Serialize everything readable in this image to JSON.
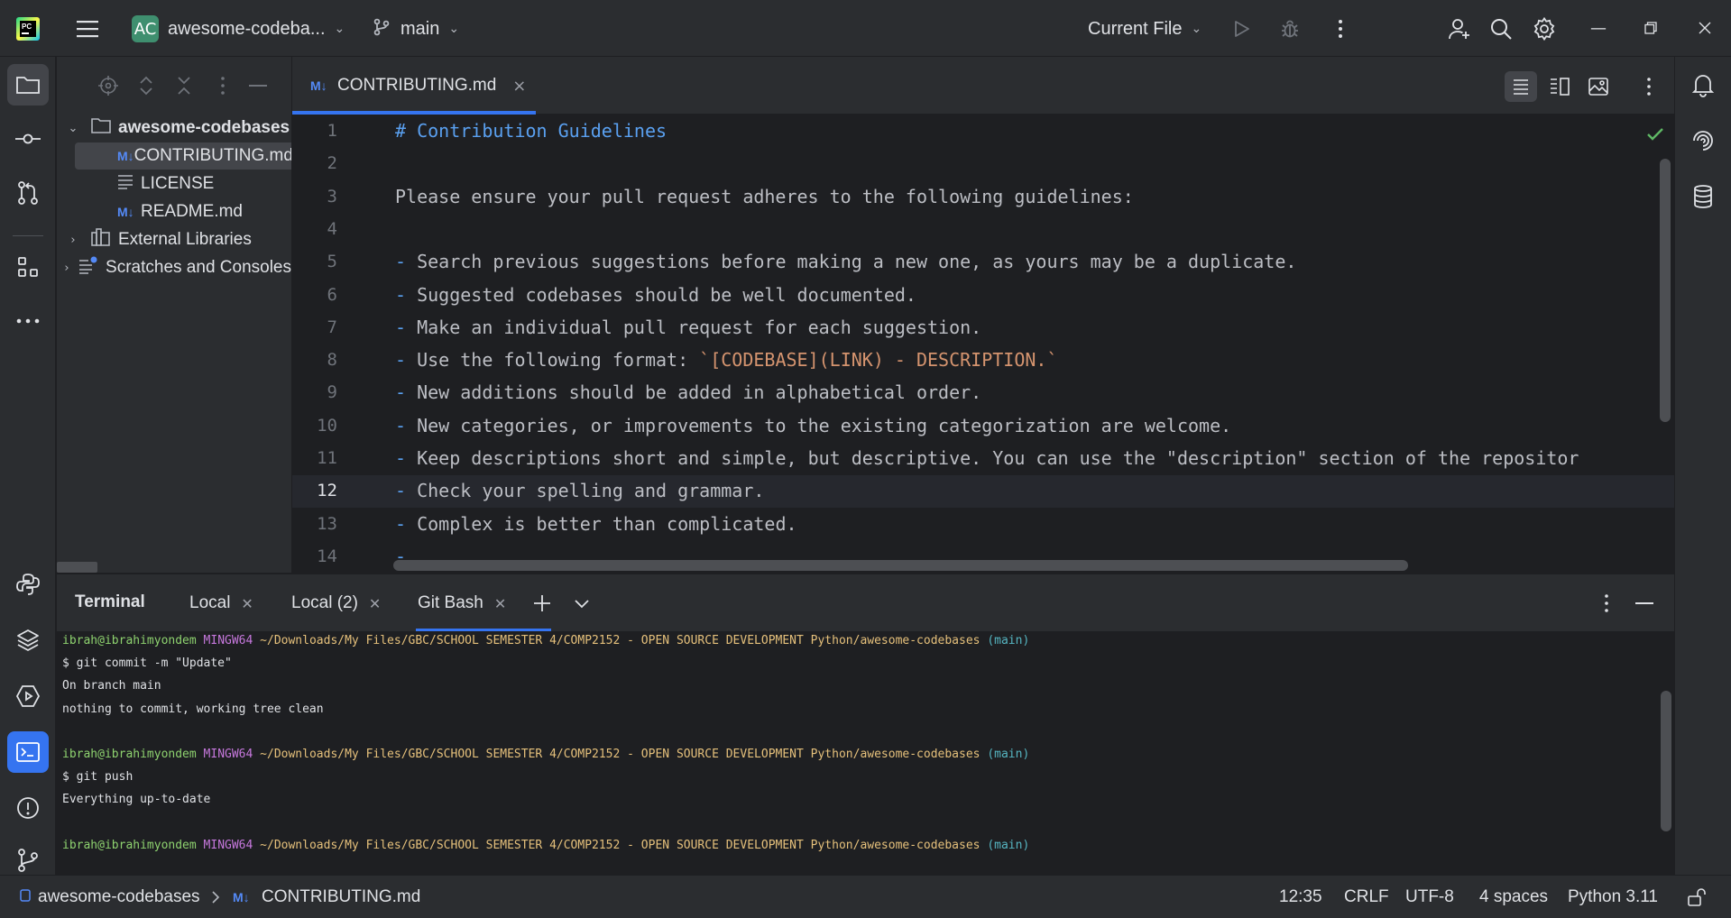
{
  "titlebar": {
    "project_avatar": "AC",
    "project_name": "awesome-codeba...",
    "branch": "main",
    "run_config": "Current File"
  },
  "project_tree": [
    {
      "label": "awesome-codebases",
      "type": "folder",
      "expanded": true,
      "bold": true
    },
    {
      "label": "CONTRIBUTING.md",
      "type": "markdown",
      "selected": true
    },
    {
      "label": "LICENSE",
      "type": "text"
    },
    {
      "label": "README.md",
      "type": "markdown"
    },
    {
      "label": "External Libraries",
      "type": "library",
      "expanded": false
    },
    {
      "label": "Scratches and Consoles",
      "type": "scratches",
      "expanded": false
    }
  ],
  "md_icon_text": "M↓",
  "editor": {
    "tab_label": "CONTRIBUTING.md",
    "current_line": 12,
    "line_numbers": [
      "1",
      "2",
      "3",
      "4",
      "5",
      "6",
      "7",
      "8",
      "9",
      "10",
      "11",
      "12",
      "13",
      "14"
    ],
    "lines": [
      [
        {
          "t": "# Contribution Guidelines",
          "c": "md-head"
        }
      ],
      [],
      [
        {
          "t": "Please ensure your pull request adheres to the following guidelines:",
          "c": ""
        }
      ],
      [],
      [
        {
          "t": "-",
          "c": "md-dash"
        },
        {
          "t": " Search previous suggestions before making a new one, as yours may be a duplicate.",
          "c": ""
        }
      ],
      [
        {
          "t": "-",
          "c": "md-dash"
        },
        {
          "t": " Suggested codebases should be well documented.",
          "c": ""
        }
      ],
      [
        {
          "t": "-",
          "c": "md-dash"
        },
        {
          "t": " Make an individual pull request for each suggestion.",
          "c": ""
        }
      ],
      [
        {
          "t": "-",
          "c": "md-dash"
        },
        {
          "t": " Use the following format: ",
          "c": ""
        },
        {
          "t": "`[CODEBASE](LINK) - DESCRIPTION.`",
          "c": "md-code"
        }
      ],
      [
        {
          "t": "-",
          "c": "md-dash"
        },
        {
          "t": " New additions should be added in alphabetical order.",
          "c": ""
        }
      ],
      [
        {
          "t": "-",
          "c": "md-dash"
        },
        {
          "t": " New categories, or improvements to the existing categorization are welcome.",
          "c": ""
        }
      ],
      [
        {
          "t": "-",
          "c": "md-dash"
        },
        {
          "t": " Keep descriptions short and simple, but descriptive. You can use the \"description\" section of the repositor",
          "c": ""
        }
      ],
      [
        {
          "t": "-",
          "c": "md-dash"
        },
        {
          "t": " Check your spelling and grammar.",
          "c": ""
        }
      ],
      [
        {
          "t": "-",
          "c": "md-dash"
        },
        {
          "t": " Complex is better than complicated.",
          "c": ""
        }
      ],
      [
        {
          "t": "-",
          "c": "md-dash"
        }
      ]
    ]
  },
  "terminal": {
    "title": "Terminal",
    "tabs": [
      "Local",
      "Local (2)",
      "Git Bash"
    ],
    "active_tab": "Git Bash",
    "prompt": {
      "user": "ibrah@ibrahimyondem",
      "host": "MINGW64",
      "path": "~/Downloads/My Files/GBC/SCHOOL SEMESTER 4/COMP2152 - OPEN SOURCE DEVELOPMENT Python/awesome-codebases",
      "branch": "(main)"
    },
    "lines": [
      {
        "kind": "prompt"
      },
      {
        "kind": "text",
        "text": "$ git commit -m \"Update\""
      },
      {
        "kind": "text",
        "text": "On branch main"
      },
      {
        "kind": "text",
        "text": "nothing to commit, working tree clean"
      },
      {
        "kind": "blank"
      },
      {
        "kind": "prompt"
      },
      {
        "kind": "text",
        "text": "$ git push"
      },
      {
        "kind": "text",
        "text": "Everything up-to-date"
      },
      {
        "kind": "blank"
      },
      {
        "kind": "prompt"
      }
    ]
  },
  "statusbar": {
    "project": "awesome-codebases",
    "file": "CONTRIBUTING.md",
    "position": "12:35",
    "line_separator": "CRLF",
    "encoding": "UTF-8",
    "indent": "4 spaces",
    "interpreter": "Python 3.11"
  },
  "colors": {
    "accent": "#3574f0",
    "markdown_icon": "#548af7",
    "project_avatar": "#3f8f6f",
    "inspection_ok": "#5fb865"
  }
}
